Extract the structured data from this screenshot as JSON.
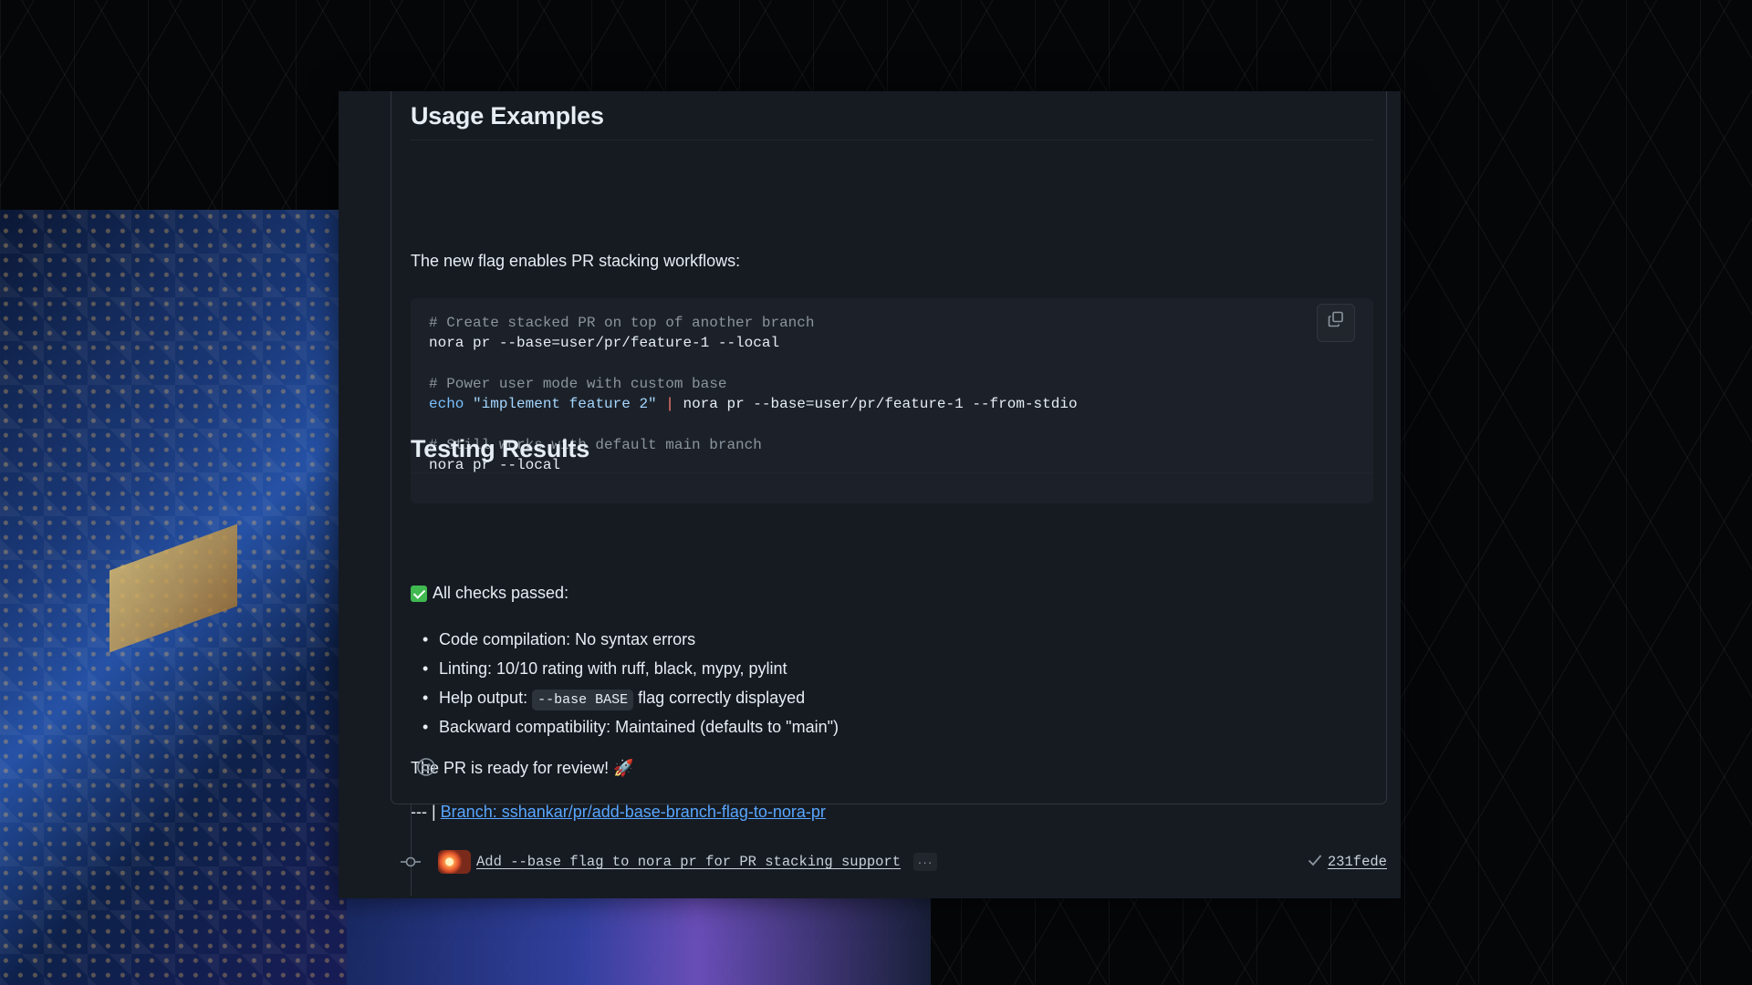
{
  "section_usage": {
    "heading": "Usage Examples",
    "intro": "The new flag enables PR stacking workflows:",
    "code_lines": [
      {
        "parts": [
          {
            "t": "# Create stacked PR on top of another branch",
            "c": "comment"
          }
        ]
      },
      {
        "parts": [
          {
            "t": "nora pr --base=user/pr/feature-1 --local",
            "c": "plain"
          }
        ]
      },
      {
        "parts": []
      },
      {
        "parts": [
          {
            "t": "# Power user mode with custom base",
            "c": "comment"
          }
        ]
      },
      {
        "parts": [
          {
            "t": "echo",
            "c": "kw"
          },
          {
            "t": " ",
            "c": "plain"
          },
          {
            "t": "\"implement feature 2\"",
            "c": "str"
          },
          {
            "t": " ",
            "c": "plain"
          },
          {
            "t": "|",
            "c": "pipe"
          },
          {
            "t": " nora pr --base=user/pr/feature-1 --from-stdio",
            "c": "plain"
          }
        ]
      },
      {
        "parts": []
      },
      {
        "parts": [
          {
            "t": "# Still works with default main branch",
            "c": "comment"
          }
        ]
      },
      {
        "parts": [
          {
            "t": "nora pr --local",
            "c": "plain"
          }
        ]
      }
    ],
    "copy_icon": "copy-icon"
  },
  "section_testing": {
    "heading": "Testing Results",
    "checks_label": "All checks passed:",
    "check_icon": "checkbox-checked-icon",
    "items": [
      {
        "text": "Code compilation: No syntax errors"
      },
      {
        "text": "Linting: 10/10 rating with ruff, black, mypy, pylint"
      },
      {
        "pre": "Help output: ",
        "code": "--base BASE",
        "post": " flag correctly displayed"
      },
      {
        "text": "Backward compatibility: Maintained (defaults to \"main\")"
      }
    ],
    "ready": "The PR is ready for review! 🚀",
    "branch_prefix": "--- | ",
    "branch_link": "Branch: sshankar/pr/add-base-branch-flag-to-nora-pr"
  },
  "reaction_icon": "smiley-icon",
  "commit": {
    "message": "Add --base flag to nora pr for PR stacking support",
    "more": "···",
    "sha": "231fede",
    "status_icon": "check-icon",
    "commit_icon": "git-commit-icon"
  },
  "colors": {
    "panel_bg": "#161b22",
    "link": "#58a6ff",
    "success": "#3fb950"
  }
}
